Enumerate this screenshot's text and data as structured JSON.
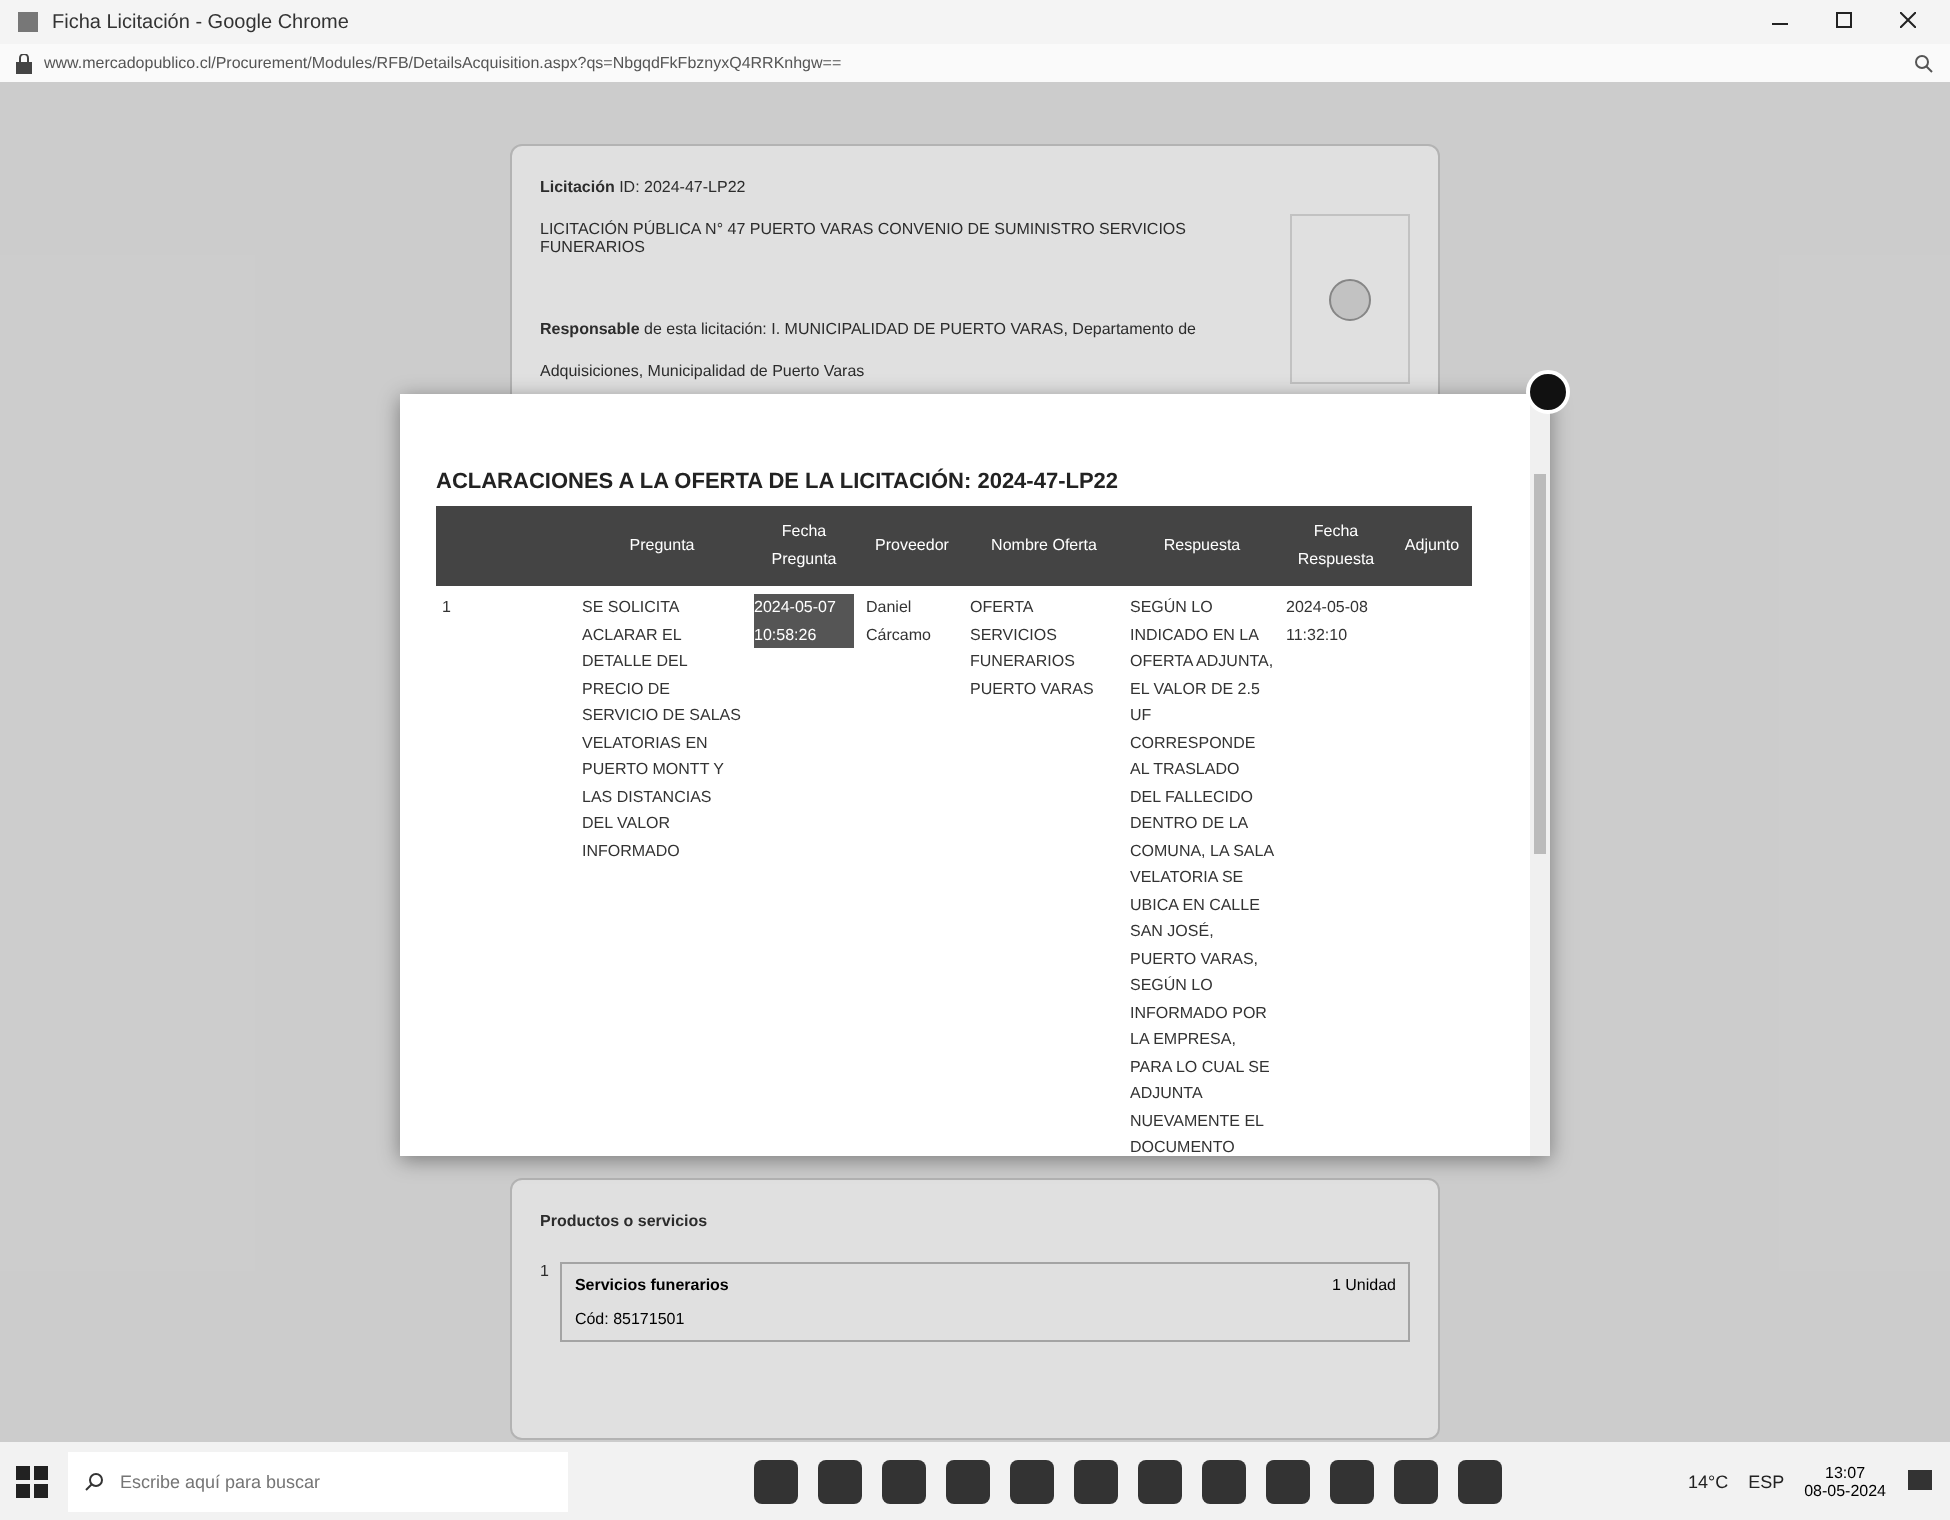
{
  "window": {
    "title": "Ficha Licitación - Google Chrome"
  },
  "address_bar": {
    "url": "www.mercadopublico.cl/Procurement/Modules/RFB/DetailsAcquisition.aspx?qs=NbgqdFkFbznyxQ4RRKnhgw=="
  },
  "tender_card": {
    "id_line": "**Licitación** ID: 2024-47-LP22",
    "description": "LICITACIÓN PÚBLICA N° 47 PUERTO VARAS CONVENIO DE SUMINISTRO SERVICIOS FUNERARIOS",
    "responsible": "**Responsable** de esta licitación: I. MUNICIPALIDAD DE PUERTO VARAS, Departamento de",
    "responsible_more": "Adquisiciones, Municipalidad de Puerto Varas"
  },
  "modal": {
    "title": "ACLARACIONES A LA OFERTA DE LA LICITACIÓN: 2024-47-LP22",
    "columns": [
      "Pregunta",
      "Fecha Pregunta",
      "Proveedor",
      "Nombre Oferta",
      "Respuesta",
      "Fecha Respuesta",
      "Adjunto"
    ],
    "rows": [
      {
        "number": "1",
        "question": "SE SOLICITA ACLARAR EL DETALLE DEL PRECIO DE SERVICIO DE SALAS VELATORIAS EN PUERTO MONTT Y LAS DISTANCIAS DEL VALOR INFORMADO",
        "question_date": "2024-05-07 10:58:26",
        "supplier": "Daniel Cárcamo",
        "offer_name": "OFERTA SERVICIOS FUNERARIOS PUERTO VARAS",
        "answer": "SEGÚN LO INDICADO EN LA OFERTA ADJUNTA, EL VALOR DE 2.5 UF CORRESPONDE AL TRASLADO DEL FALLECIDO DENTRO DE LA COMUNA, LA SALA VELATORIA SE UBICA EN CALLE SAN JOSÉ, PUERTO VARAS, SEGÚN LO INFORMADO POR LA EMPRESA, PARA LO CUAL SE ADJUNTA NUEVAMENTE EL DOCUMENTO",
        "answer_date": "2024-05-08 11:32:10",
        "attachment": ""
      }
    ]
  },
  "products_card": {
    "heading": "Productos o servicios",
    "items": [
      {
        "number": "1",
        "name": "Servicios funerarios",
        "code": "Cód: 85171501",
        "quantity": "1 Unidad"
      }
    ]
  },
  "taskbar": {
    "search_placeholder": "Escribe aquí para buscar",
    "weather": "14°C",
    "language": "ESP",
    "time": "13:07",
    "date": "08-05-2024"
  }
}
